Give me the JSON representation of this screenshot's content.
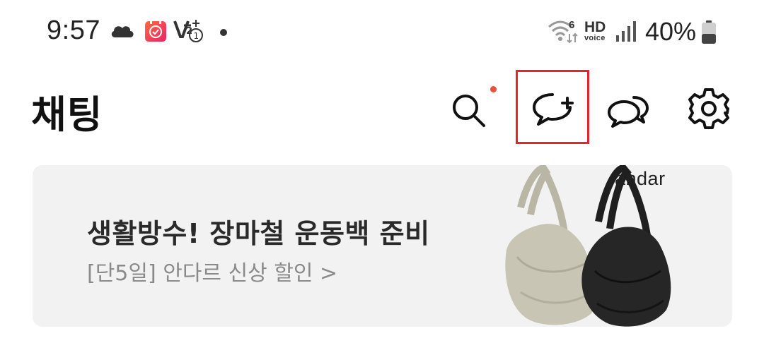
{
  "status_bar": {
    "time": "9:57",
    "battery": "40%",
    "hd_label": "HD",
    "voice_label": "voice",
    "wifi_badge": "6",
    "icons": [
      "cloud-icon",
      "calendar-app-icon",
      "vpn-key-icon",
      "notification-dot",
      "wifi-icon",
      "hd-voice-icon",
      "signal-icon",
      "battery-icon"
    ]
  },
  "header": {
    "title": "채팅",
    "actions": [
      "search-icon",
      "new-chat-icon",
      "open-chat-icon",
      "settings-icon"
    ],
    "search_badge_color": "#e8503a",
    "highlight_color": "#e0262e"
  },
  "banner": {
    "title": "생활방수! 장마철 운동백 준비",
    "subtitle": "[단5일] 안다르 신상 할인 >",
    "brand": "andar",
    "background": "#f2f2f2"
  }
}
